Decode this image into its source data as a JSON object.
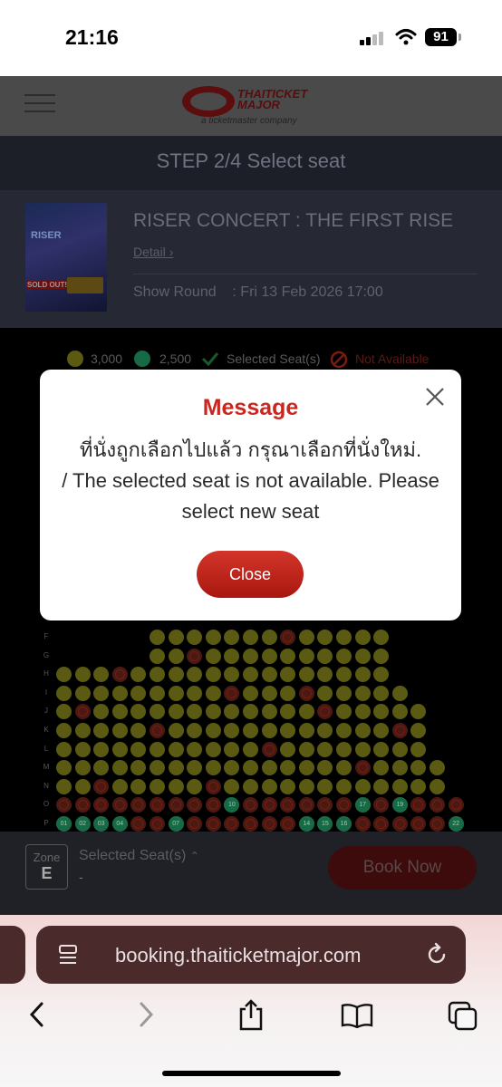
{
  "status_bar": {
    "time": "21:16",
    "battery": "91"
  },
  "header": {
    "logo_main": "THAITICKET MAJOR",
    "logo_sub": "a ticketmaster company"
  },
  "step": {
    "label": "STEP 2/4 Select seat"
  },
  "event": {
    "title": "RISER CONCERT : THE FIRST RISE",
    "detail_link": "Detail",
    "show_round": "Show Round    : Fri 13 Feb 2026 17:00",
    "poster_text": "RISER",
    "poster_badge": "SOLD OUT!"
  },
  "legend": {
    "price_high": "3,000",
    "price_low": "2,500",
    "selected": "Selected Seat(s)",
    "not_available": "Not Available",
    "color_high": "#5a5a12",
    "color_low": "#176a46"
  },
  "seat_rows": [
    "F",
    "G",
    "H",
    "I",
    "J",
    "K",
    "L",
    "M",
    "N",
    "O",
    "P"
  ],
  "seat_numbers": {
    "O": [
      "10",
      "17",
      "19"
    ],
    "P": [
      "01",
      "02",
      "03",
      "04",
      "07",
      "14",
      "15",
      "16",
      "22"
    ]
  },
  "booking": {
    "zone_label": "Zone",
    "zone_value": "E",
    "selected_label": "Selected Seat(s)",
    "selected_value": "-",
    "book_button": "Book Now"
  },
  "browser": {
    "url": "booking.thaiticketmajor.com"
  },
  "modal": {
    "title": "Message",
    "message_th": "ที่นั่งถูกเลือกไปแล้ว กรุณาเลือกที่นั่งใหม่.",
    "message_en": "/ The selected seat is not available. Please select new seat",
    "close_button": "Close",
    "accent_color": "#c8281f"
  }
}
